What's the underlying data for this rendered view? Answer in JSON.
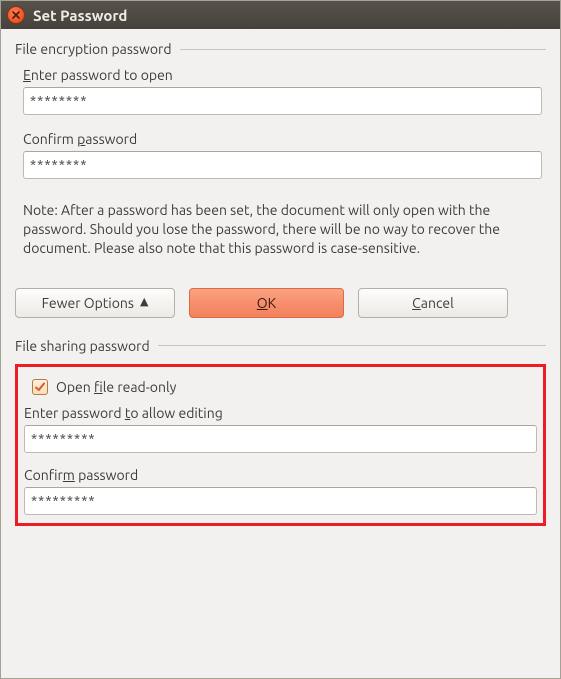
{
  "window": {
    "title": "Set Password"
  },
  "encryption": {
    "group_label": "File encryption password",
    "enter_label_pre": "E",
    "enter_label_post": "nter password to open",
    "enter_value": "********",
    "confirm_label_pre": "Confirm ",
    "confirm_label_u": "p",
    "confirm_label_post": "assword",
    "confirm_value": "********",
    "note": "Note: After a password has been set, the document will only open with the password. Should you lose the password, there will be no way to recover the document. Please also note that this password is case-sensitive."
  },
  "buttons": {
    "options_label": "Fewer Options",
    "ok_pre": "O",
    "ok_u": "K",
    "cancel_u": "C",
    "cancel_post": "ancel"
  },
  "sharing": {
    "group_label": "File sharing password",
    "readonly_pre": "Open ",
    "readonly_u": "f",
    "readonly_post": "ile read-only",
    "readonly_checked": true,
    "enter_label_pre": "Enter password ",
    "enter_label_u": "t",
    "enter_label_post": "o allow editing",
    "enter_value": "*********",
    "confirm_label_pre": "Confir",
    "confirm_label_u": "m",
    "confirm_label_post": " password",
    "confirm_value": "*********"
  }
}
